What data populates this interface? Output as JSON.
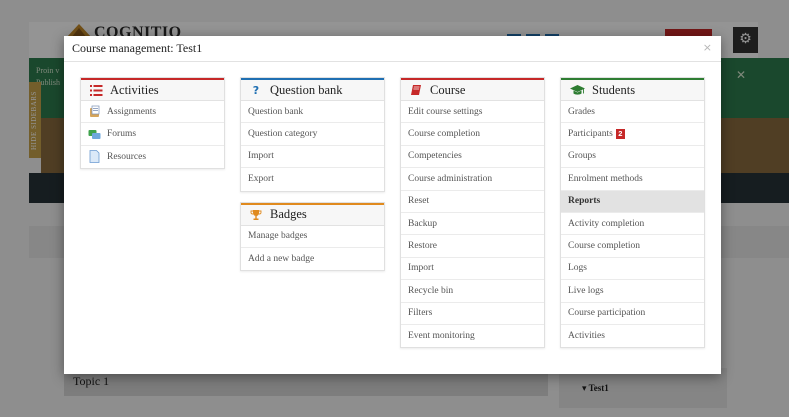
{
  "background": {
    "logo_text": "COGNITIO",
    "banner_line1": "Proin v",
    "banner_line2": "Publish",
    "sidebar_tab_label": "HIDE SIDEBARS",
    "topic_label": "Topic 1",
    "block_item_label": "▾ Test1"
  },
  "modal": {
    "title": "Course management: Test1",
    "close_symbol": "×"
  },
  "sections": {
    "activities": {
      "title": "Activities",
      "accent": "#c62828",
      "items": [
        {
          "label": "Assignments",
          "icon": "assignment-icon"
        },
        {
          "label": "Forums",
          "icon": "forum-icon"
        },
        {
          "label": "Resources",
          "icon": "resource-icon"
        }
      ]
    },
    "question_bank": {
      "title": "Question bank",
      "accent": "#1f6fb2",
      "icon_glyph": "?",
      "items": [
        {
          "label": "Question bank"
        },
        {
          "label": "Question category"
        },
        {
          "label": "Import"
        },
        {
          "label": "Export"
        }
      ]
    },
    "badges": {
      "title": "Badges",
      "accent": "#e08a1e",
      "items": [
        {
          "label": "Manage badges"
        },
        {
          "label": "Add a new badge"
        }
      ]
    },
    "course": {
      "title": "Course",
      "accent": "#c62828",
      "items": [
        {
          "label": "Edit course settings"
        },
        {
          "label": "Course completion"
        },
        {
          "label": "Competencies"
        },
        {
          "label": "Course administration"
        },
        {
          "label": "Reset"
        },
        {
          "label": "Backup"
        },
        {
          "label": "Restore"
        },
        {
          "label": "Import"
        },
        {
          "label": "Recycle bin"
        },
        {
          "label": "Filters"
        },
        {
          "label": "Event monitoring"
        }
      ]
    },
    "students": {
      "title": "Students",
      "accent": "#2e7d32",
      "participants_badge": "2",
      "items": [
        {
          "label": "Grades"
        },
        {
          "label": "Participants"
        },
        {
          "label": "Groups"
        },
        {
          "label": "Enrolment methods"
        },
        {
          "label": "Reports"
        },
        {
          "label": "Activity completion"
        },
        {
          "label": "Course completion"
        },
        {
          "label": "Logs"
        },
        {
          "label": "Live logs"
        },
        {
          "label": "Course participation"
        },
        {
          "label": "Activities"
        }
      ]
    }
  }
}
